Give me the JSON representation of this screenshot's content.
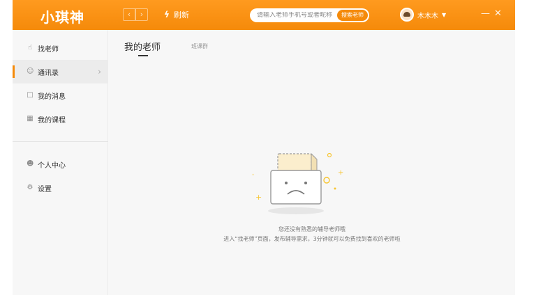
{
  "app": {
    "logo": "小琪神"
  },
  "toolbar": {
    "back_icon": "chevron-left-icon",
    "forward_icon": "chevron-right-icon",
    "refresh_label": "刷新"
  },
  "search": {
    "placeholder": "请输入老师手机号或者昵称",
    "button_label": "搜索老师"
  },
  "user": {
    "name": "木木木"
  },
  "sidebar": {
    "items": [
      {
        "label": "找老师",
        "icon": "hand-icon"
      },
      {
        "label": "通讯录",
        "icon": "contacts-icon"
      },
      {
        "label": "我的消息",
        "icon": "message-icon"
      },
      {
        "label": "我的课程",
        "icon": "course-icon"
      },
      {
        "label": "个人中心",
        "icon": "user-icon"
      },
      {
        "label": "设置",
        "icon": "gear-icon"
      }
    ]
  },
  "tabs": {
    "teachers": "我的老师",
    "classmates": "班课群"
  },
  "empty_state": {
    "line1": "您还没有熟悉的辅导老师哦",
    "line2": "进入“找老师”页面，发布辅导需求，3分钟就可以免费找到喜欢的老师啦"
  },
  "colors": {
    "accent": "#f58a0a",
    "sidebar_bg": "#f7f7f7",
    "active_bg": "#ececec"
  }
}
